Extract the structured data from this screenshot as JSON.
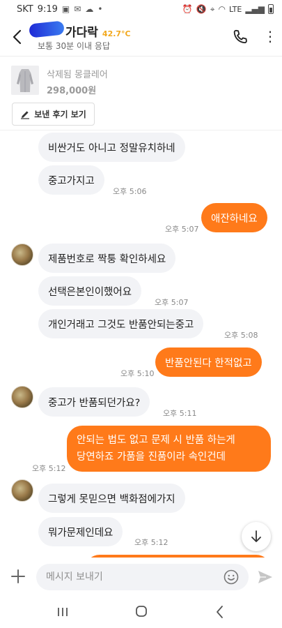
{
  "status_bar": {
    "carrier": "SKT",
    "time": "9:19",
    "network": "LTE"
  },
  "header": {
    "seller_name": "가다락",
    "temperature": "42.7°C",
    "response_time": "보통 30분 이내 응답",
    "icons": [
      "back-arrow-icon",
      "phone-icon",
      "more-vertical-icon"
    ]
  },
  "product": {
    "name": "삭제됨 몽클레어",
    "price": "298,000원",
    "review_button": "보낸 후기 보기"
  },
  "messages": [
    {
      "side": "in",
      "text": "비싼거도 아니고 정말유치하네",
      "time": ""
    },
    {
      "side": "in",
      "text": "중고가지고",
      "time": "오후 5:06"
    },
    {
      "side": "out",
      "text": "애잔하네요",
      "time": "오후 5:07"
    },
    {
      "side": "in",
      "text": "제품번호로 짝퉁 확인하세요",
      "time": ""
    },
    {
      "side": "in",
      "text": "선택은본인이했어요",
      "time": "오후 5:07"
    },
    {
      "side": "in",
      "text": "개인거래고 그것도 반품안되는중고",
      "time": "오후 5:08"
    },
    {
      "side": "out",
      "text": "반품안된다 한적없고",
      "time": "오후 5:10"
    },
    {
      "side": "in",
      "text": "중고가 반품되던가요?",
      "time": "오후 5:11"
    },
    {
      "side": "out",
      "lines": [
        "안되는 법도 없고 문제 시 반품 하는게",
        "당연하죠 가품을 진품이라 속인건데"
      ],
      "time": "오후 5:12"
    },
    {
      "side": "in",
      "text": "그렇게 못믿으면 백화점에가지",
      "time": ""
    },
    {
      "side": "in",
      "text": "뭐가문제인데요",
      "time": "오후 5:12"
    }
  ],
  "input": {
    "placeholder": "메시지 보내기"
  },
  "colors": {
    "accent": "#ff7a1a",
    "incoming_bubble": "#f2f3f6",
    "temperature": "#f2a81d"
  }
}
